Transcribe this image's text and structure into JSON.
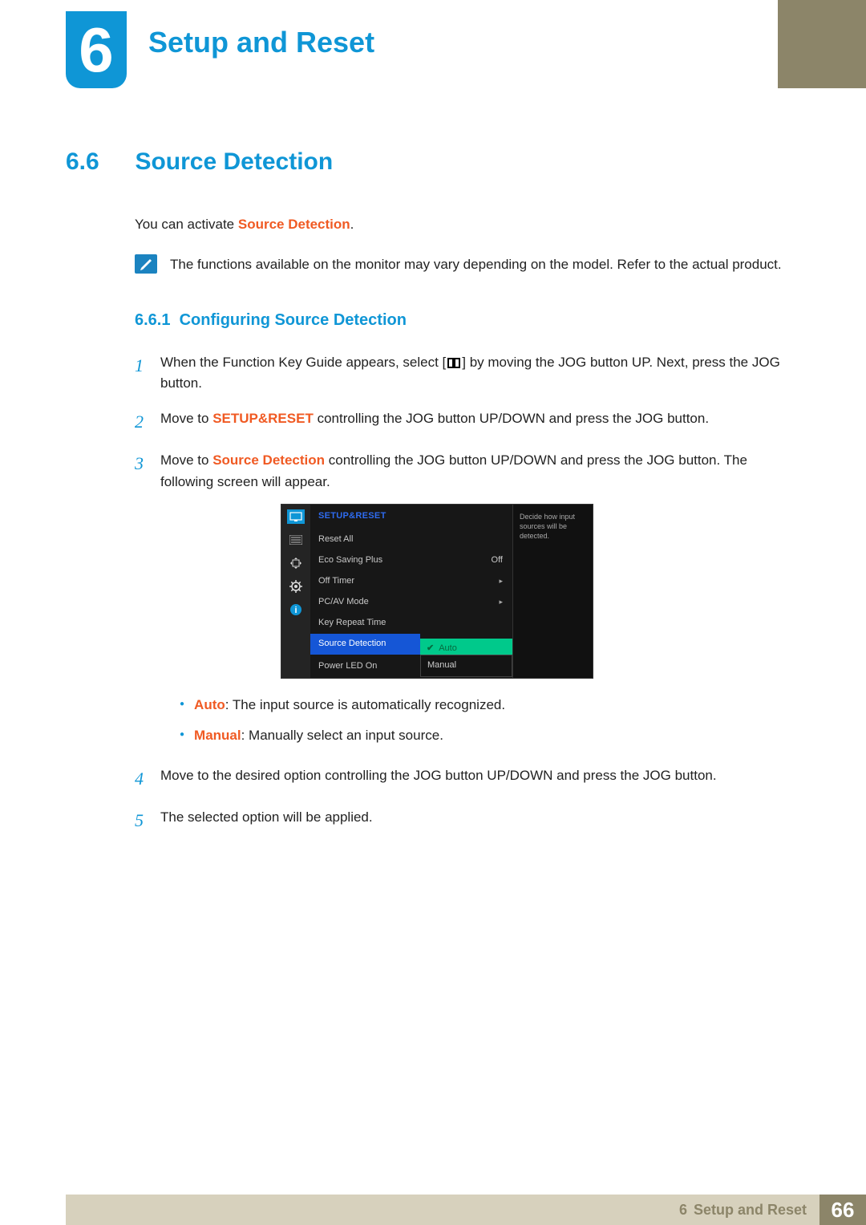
{
  "chapter": {
    "num": "6",
    "title": "Setup and Reset"
  },
  "section": {
    "num": "6.6",
    "title": "Source Detection"
  },
  "intro": {
    "prefix": "You can activate ",
    "term": "Source Detection",
    "suffix": "."
  },
  "note": "The functions available on the monitor may vary depending on the model. Refer to the actual product.",
  "subsection": {
    "num": "6.6.1",
    "title": "Configuring Source Detection"
  },
  "steps": {
    "s1a": "When the Function Key Guide appears, select [",
    "s1b": "] by moving the JOG button UP. Next, press the JOG button.",
    "s2a": "Move to ",
    "s2term": "SETUP&RESET",
    "s2b": " controlling the JOG button UP/DOWN and press the JOG button.",
    "s3a": "Move to ",
    "s3term": "Source Detection",
    "s3b": " controlling the JOG button UP/DOWN and press the JOG button. The following screen will appear.",
    "s4": "Move to the desired option controlling the JOG button UP/DOWN and press the JOG button.",
    "s5": "The selected option will be applied.",
    "num1": "1",
    "num2": "2",
    "num3": "3",
    "num4": "4",
    "num5": "5"
  },
  "options": {
    "autoLabel": "Auto",
    "autoDesc": ": The input source is automatically recognized.",
    "manualLabel": "Manual",
    "manualDesc": ": Manually select an input source."
  },
  "osd": {
    "title": "SETUP&RESET",
    "rows": {
      "reset": "Reset All",
      "eco": "Eco Saving Plus",
      "ecoVal": "Off",
      "timer": "Off Timer",
      "pcav": "PC/AV Mode",
      "key": "Key Repeat Time",
      "src": "Source Detection",
      "led": "Power LED On"
    },
    "popup": {
      "auto": "Auto",
      "manual": "Manual"
    },
    "desc": "Decide how input sources will be detected."
  },
  "footer": {
    "chapter": "6 ",
    "title": "Setup and Reset",
    "page": "66"
  }
}
